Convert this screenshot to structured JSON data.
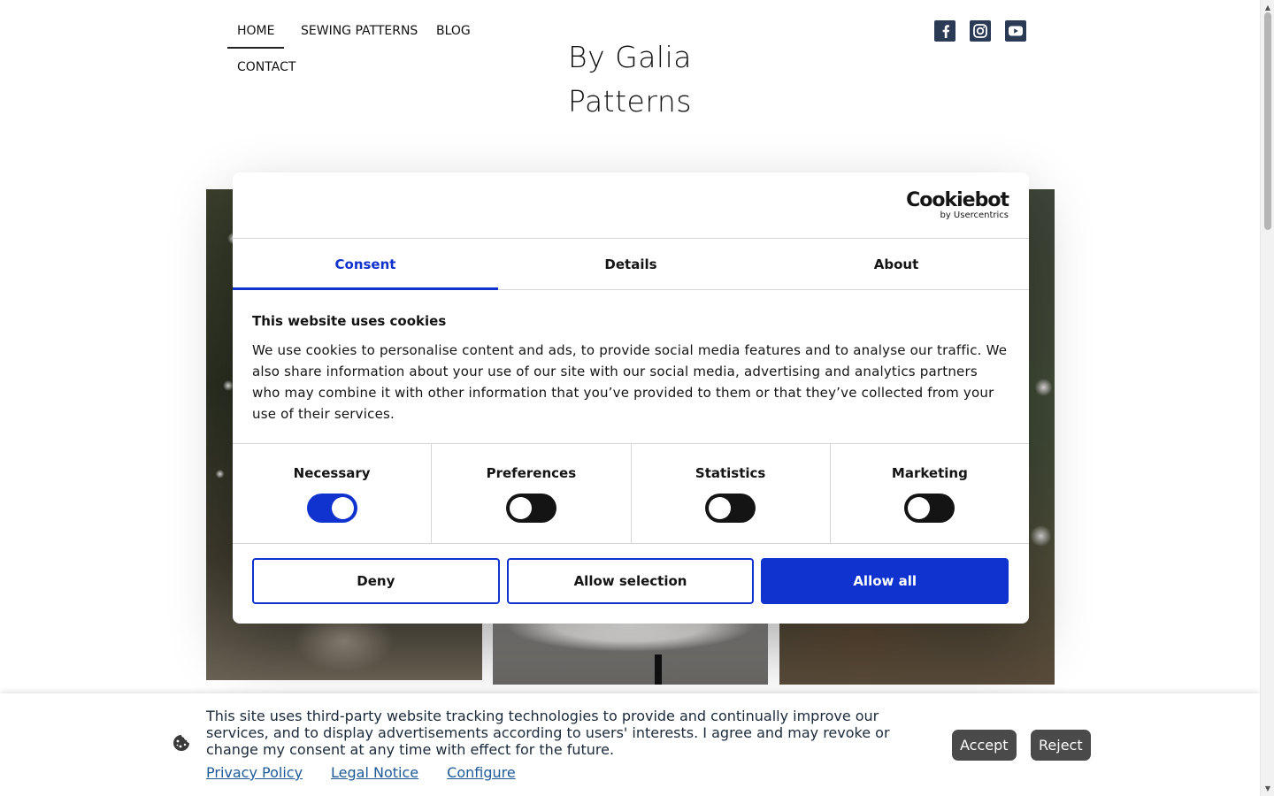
{
  "site": {
    "nav": [
      {
        "label": "HOME",
        "active": true
      },
      {
        "label": "SEWING PATTERNS"
      },
      {
        "label": "BLOG"
      },
      {
        "label": "CONTACT"
      }
    ],
    "brand_line1": "By Galia",
    "brand_line2": "Patterns",
    "social_icons": [
      "facebook-icon",
      "instagram-icon",
      "youtube-icon"
    ]
  },
  "cookiebot": {
    "logo_name": "Cookiebot",
    "logo_sub": "by Usercentrics",
    "tabs": [
      {
        "label": "Consent",
        "active": true
      },
      {
        "label": "Details"
      },
      {
        "label": "About"
      }
    ],
    "title": "This website uses cookies",
    "text": "We use cookies to personalise content and ads, to provide social media features and to analyse our traffic. We also share information about your use of our site with our social media, advertising and analytics partners who may combine it with other information that you’ve provided to them or that they’ve collected from your use of their services.",
    "categories": [
      {
        "label": "Necessary",
        "enabled": true
      },
      {
        "label": "Preferences",
        "enabled": false
      },
      {
        "label": "Statistics",
        "enabled": false
      },
      {
        "label": "Marketing",
        "enabled": false
      }
    ],
    "buttons": {
      "deny": "Deny",
      "allow_selection": "Allow selection",
      "allow_all": "Allow all"
    },
    "accent_color": "#1032cf"
  },
  "consent_bar": {
    "icon": "cookie-icon",
    "text": "This site uses third-party website tracking technologies to provide and continually improve our services, and to display advertisements according to users' interests. I agree and may revoke or change my consent at any time with effect for the future.",
    "links": [
      "Privacy Policy",
      "Legal Notice",
      "Configure"
    ],
    "accept": "Accept",
    "reject": "Reject"
  }
}
